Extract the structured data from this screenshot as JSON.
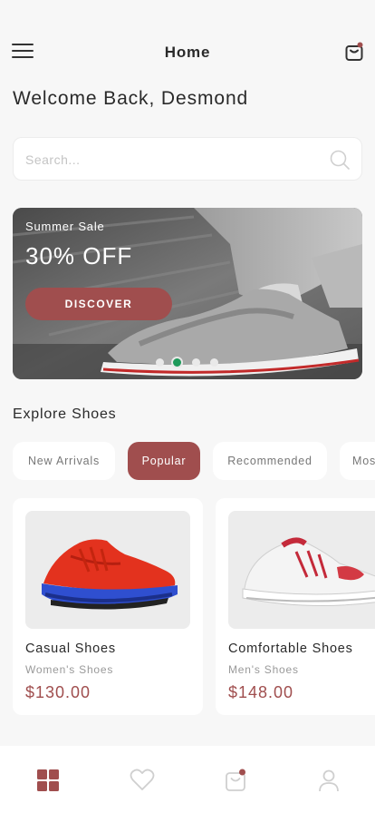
{
  "header": {
    "title": "Home",
    "menu_icon": "hamburger-menu-icon",
    "cart_icon": "shopping-bag-icon"
  },
  "welcome": "Welcome Back, Desmond",
  "search": {
    "placeholder": "Search...",
    "value": "",
    "icon": "search-icon"
  },
  "banner": {
    "subtitle": "Summer Sale",
    "title": "30% OFF",
    "button_label": "DISCOVER",
    "slides": 4,
    "active_slide": 2
  },
  "explore": {
    "title": "Explore Shoes",
    "categories": [
      "New Arrivals",
      "Popular",
      "Recommended",
      "Most"
    ],
    "selected": "Popular"
  },
  "products": [
    {
      "name": "Casual Shoes",
      "category": "Women's Shoes",
      "price": "$130.00"
    },
    {
      "name": "Comfortable Shoes",
      "category": "Men's Shoes",
      "price": "$148.00"
    }
  ],
  "bottom_nav": {
    "items": [
      "home-grid-icon",
      "heart-icon",
      "shopping-bag-icon",
      "user-icon"
    ],
    "active": "home-grid-icon"
  },
  "colors": {
    "accent": "#a04e4e",
    "indicator_active": "#1e9a5a",
    "background": "#f7f7f7"
  }
}
